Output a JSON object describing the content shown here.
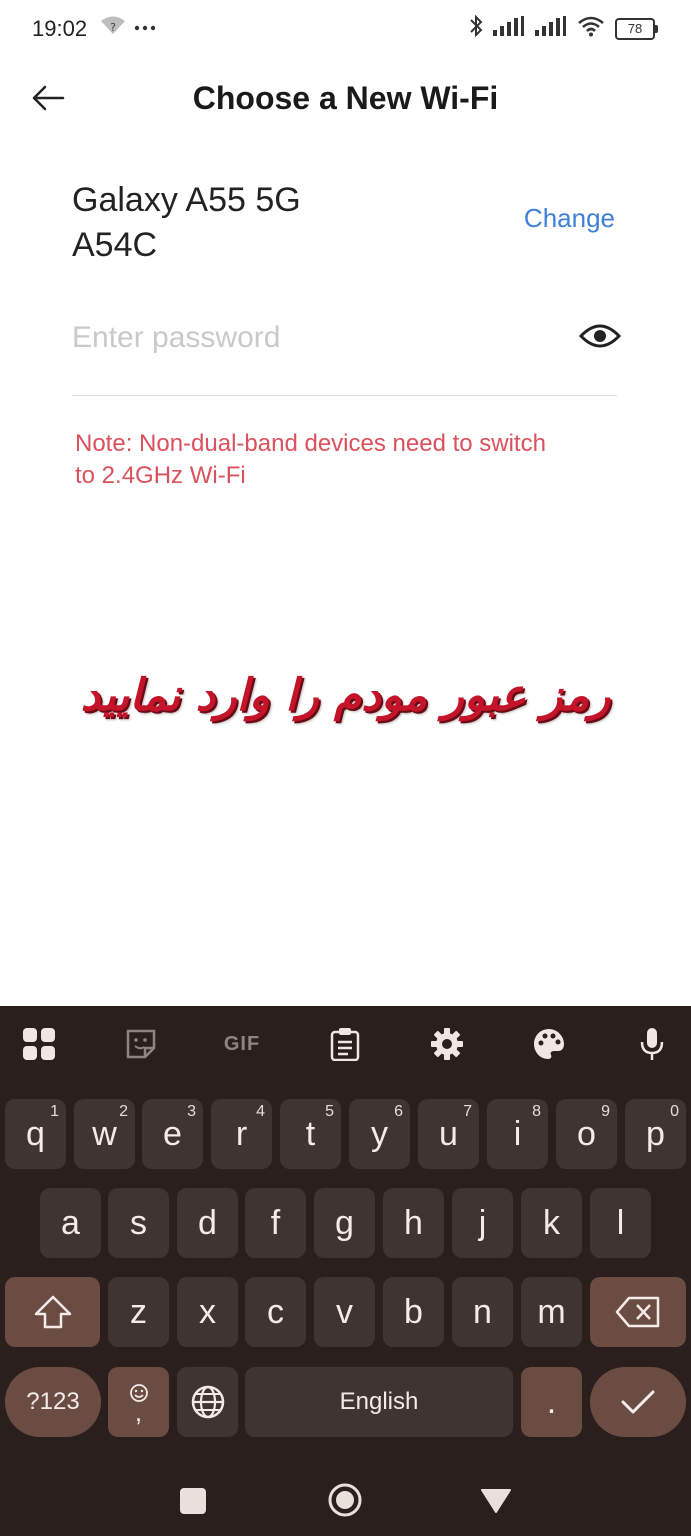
{
  "status_bar": {
    "time": "19:02",
    "battery": "78"
  },
  "header": {
    "title": "Choose a New Wi-Fi"
  },
  "network": {
    "line1": "Galaxy A55 5G",
    "line2": "A54C",
    "change_label": "Change"
  },
  "password": {
    "placeholder": "Enter password"
  },
  "note": {
    "line1": "Note: Non-dual-band devices need to switch",
    "line2": "to 2.4GHz Wi-Fi"
  },
  "overlay": {
    "caption": "رمز عبور مودم را وارد نمایید"
  },
  "keyboard": {
    "toolbar": [
      "apps-grid-icon",
      "sticker-icon",
      "gif-icon",
      "clipboard-icon",
      "gear-icon",
      "palette-icon",
      "microphone-icon"
    ],
    "gif_label": "GIF",
    "row1": [
      {
        "label": "q",
        "hint": "1"
      },
      {
        "label": "w",
        "hint": "2"
      },
      {
        "label": "e",
        "hint": "3"
      },
      {
        "label": "r",
        "hint": "4"
      },
      {
        "label": "t",
        "hint": "5"
      },
      {
        "label": "y",
        "hint": "6"
      },
      {
        "label": "u",
        "hint": "7"
      },
      {
        "label": "i",
        "hint": "8"
      },
      {
        "label": "o",
        "hint": "9"
      },
      {
        "label": "p",
        "hint": "0"
      }
    ],
    "row2": [
      "a",
      "s",
      "d",
      "f",
      "g",
      "h",
      "j",
      "k",
      "l"
    ],
    "row3": [
      "z",
      "x",
      "c",
      "v",
      "b",
      "n",
      "m"
    ],
    "symbols_label": "?123",
    "comma_label": ",",
    "space_label": "English",
    "period_label": "."
  },
  "colors": {
    "accent_link": "#3f7fd8",
    "note": "#d9515c",
    "keyboard_bg": "#2b1f1d",
    "key": "#3f3432",
    "key_dark": "#6b4c42"
  }
}
